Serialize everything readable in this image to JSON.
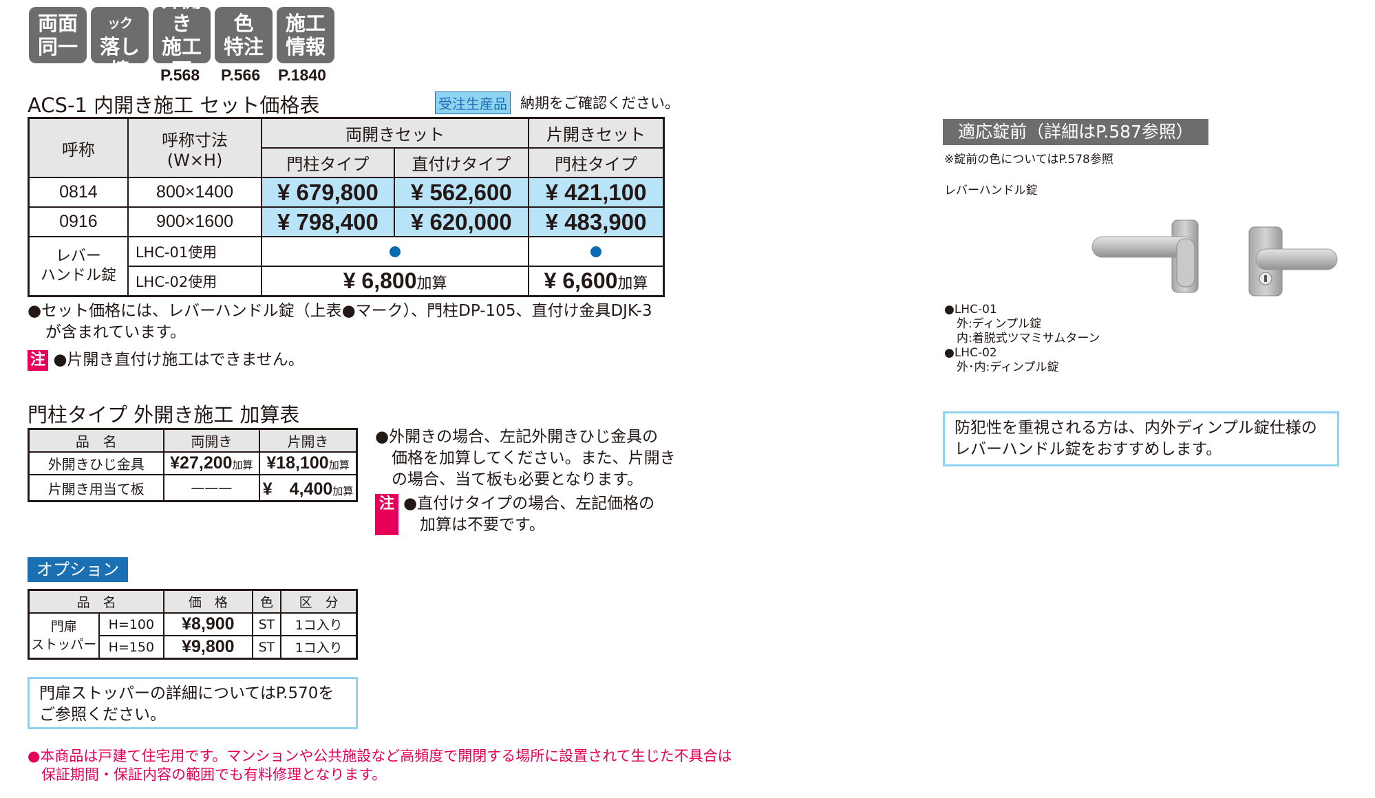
{
  "badges": [
    {
      "line1": "両面",
      "line2": "同一"
    },
    {
      "line1": "オートロック",
      "line2": "落し棒"
    },
    {
      "line1": "外開き",
      "line2": "施工可"
    },
    {
      "line1": "色",
      "line2": "特注"
    },
    {
      "line1": "施工",
      "line2": "情報"
    }
  ],
  "page_refs": [
    "P.568",
    "P.566",
    "P.1840"
  ],
  "main_title": "ACS-1 内開き施工 セット価格表",
  "order_tag": "受注生産品",
  "order_note": "納期をご確認ください。",
  "main_table": {
    "h_name": "呼称",
    "h_size_1": "呼称寸法",
    "h_size_2": "(W×H)",
    "h_double": "両開きセット",
    "h_single": "片開きセット",
    "h_post": "門柱タイプ",
    "h_direct": "直付けタイプ",
    "h_post2": "門柱タイプ",
    "rows": [
      {
        "name": "0814",
        "size": "800×1400",
        "double_post": "¥ 679,800",
        "double_direct": "¥ 562,600",
        "single_post": "¥ 421,100"
      },
      {
        "name": "0916",
        "size": "900×1600",
        "double_post": "¥ 798,400",
        "double_direct": "¥ 620,000",
        "single_post": "¥ 483,900"
      }
    ],
    "lever_label_1": "レバー",
    "lever_label_2": "ハンドル錠",
    "lhc01": "LHC-01使用",
    "lhc02": "LHC-02使用",
    "lhc02_double": "¥ 6,800",
    "lhc02_single": "¥ 6,600",
    "kasan": "加算"
  },
  "note1_line1": "●セット価格には、レバーハンドル錠（上表●マーク）、門柱DP-105、直付け金具DJK-3",
  "note1_line2": "が含まれています。",
  "note_icon": "注",
  "note2": "●片開き直付け施工はできません。",
  "out_title": "門柱タイプ 外開き施工 加算表",
  "out_table": {
    "h_item": "品　名",
    "h_double": "両開き",
    "h_single": "片開き",
    "rows": [
      {
        "item": "外開きひじ金具",
        "double": "¥27,200",
        "single": "¥18,100"
      },
      {
        "item": "片開き用当て板",
        "double": "———",
        "single": "¥　4,400"
      }
    ],
    "kasan": "加算"
  },
  "out_note1": [
    "●外開きの場合、左記外開きひじ金具の",
    "価格を加算してください。また、片開き",
    "の場合、当て板も必要となります。"
  ],
  "out_note2": [
    "●直付けタイプの場合、左記価格の",
    "加算は不要です。"
  ],
  "option_tag": "オプション",
  "opt_table": {
    "h_item": "品　名",
    "h_price": "価　格",
    "h_color": "色",
    "h_unit": "区　分",
    "item_1": "門扉",
    "item_2": "ストッパー",
    "rows": [
      {
        "spec": "H=100",
        "price": "¥8,900",
        "color": "ST",
        "unit": "1コ入り"
      },
      {
        "spec": "H=150",
        "price": "¥9,800",
        "color": "ST",
        "unit": "1コ入り"
      }
    ]
  },
  "stopper_box": [
    "門扉ストッパーの詳細についてはP.570を",
    "ご参照ください。"
  ],
  "pink_note": [
    "●本商品は戸建て住宅用です。マンションや公共施設など高頻度で開閉する場所に設置されて生じた不具合は",
    "保証期間・保証内容の範囲でも有料修理となります。"
  ],
  "right": {
    "title": "適応錠前（詳細はP.587参照）",
    "color_note": "※錠前の色についてはP.578参照",
    "lever_caption": "レバーハンドル錠",
    "lhc01_title": "●LHC-01",
    "lhc01_out": "外:ディンプル錠",
    "lhc01_in": "内:着脱式ツマミサムターン",
    "lhc02_title": "●LHC-02",
    "lhc02_spec": "外･内:ディンプル錠",
    "recommend": [
      "防犯性を重視される方は、内外ディンプル錠仕様の",
      "レバーハンドル錠をおすすめします。"
    ]
  },
  "colors": {
    "badge_gray": "#6d6d6d",
    "price_blue": "#b9e3f6",
    "accent_blue": "#1b6fb3",
    "dot_blue": "#0a6ab1",
    "pink": "#e6005a",
    "box_cyan": "#8fd3f0",
    "header_gray": "#e6e6e6"
  }
}
